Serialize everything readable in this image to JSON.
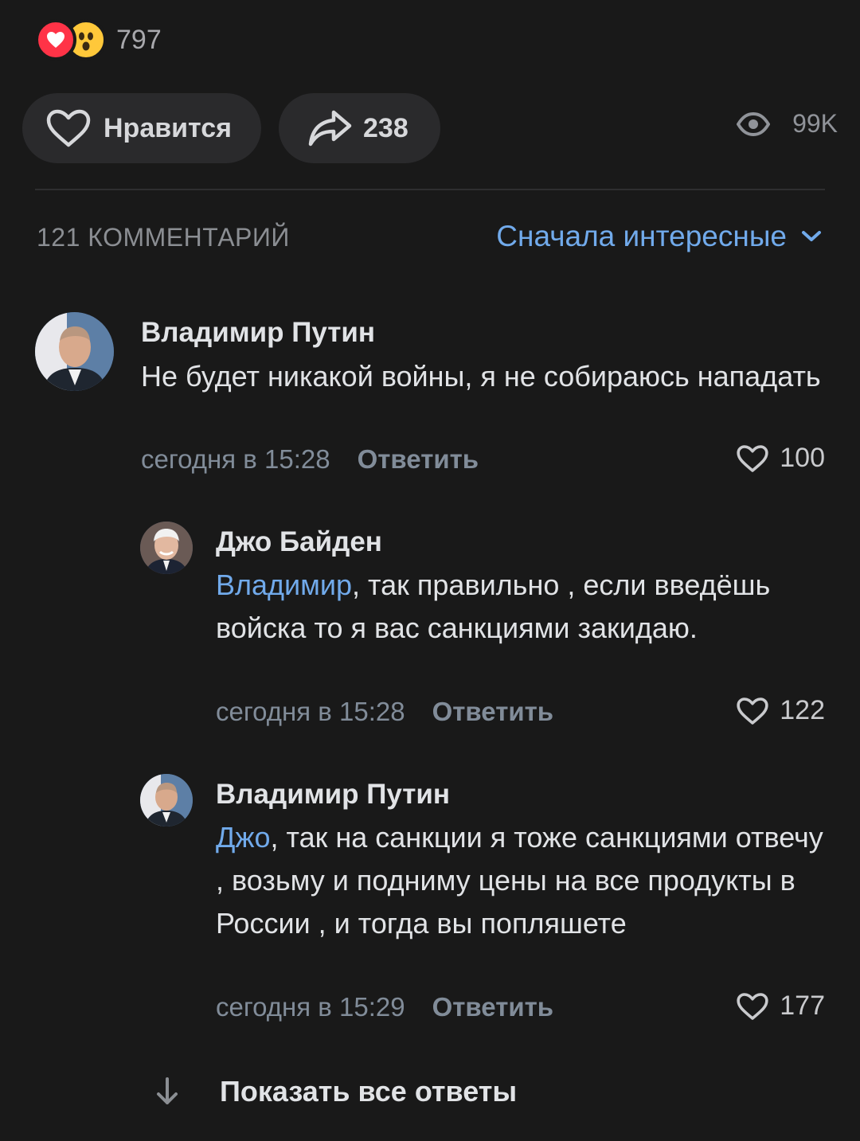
{
  "reactions": {
    "count": "797",
    "icons": [
      "heart-reaction-icon",
      "wow-reaction-icon"
    ]
  },
  "actions": {
    "like_label": "Нравится",
    "share_count": "238",
    "views": "99K"
  },
  "comments_header": {
    "count_label": "121 КОММЕНТАРИЙ",
    "sort_label": "Сначала интересные"
  },
  "comments": [
    {
      "author": "Владимир Путин",
      "mention": "",
      "text": "Не будет никакой войны, я не собираюсь нападать",
      "time": "сегодня в 15:28",
      "reply_label": "Ответить",
      "likes": "100"
    },
    {
      "author": "Джо Байден",
      "mention": "Владимир",
      "text": ", так правильно , если введёшь войска то я вас санкциями закидаю.",
      "time": "сегодня в 15:28",
      "reply_label": "Ответить",
      "likes": "122"
    },
    {
      "author": "Владимир Путин",
      "mention": "Джо",
      "text": ", так на санкции я тоже санкциями отвечу , возьму и подниму цены на все продукты в России , и тогда вы попляшете",
      "time": "сегодня в 15:29",
      "reply_label": "Ответить",
      "likes": "177"
    }
  ],
  "show_all_label": "Показать все ответы",
  "colors": {
    "background": "#191919",
    "accent": "#71aaeb",
    "pill": "#2a2a2c",
    "heart": "#ff3347"
  }
}
